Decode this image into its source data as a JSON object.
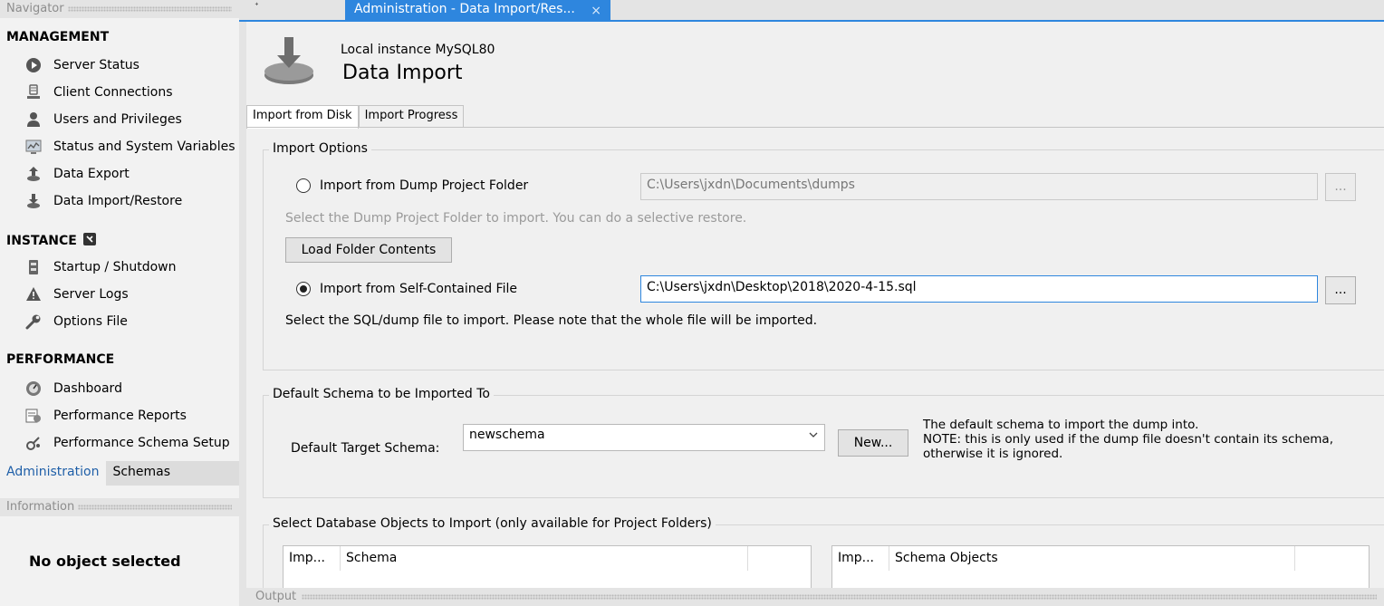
{
  "sidebar": {
    "navigator_title": "Navigator",
    "management_title": "MANAGEMENT",
    "management_items": [
      {
        "label": "Server Status",
        "icon": "server-status-icon"
      },
      {
        "label": "Client Connections",
        "icon": "client-connections-icon"
      },
      {
        "label": "Users and Privileges",
        "icon": "users-icon"
      },
      {
        "label": "Status and System Variables",
        "icon": "system-variables-icon"
      },
      {
        "label": "Data Export",
        "icon": "data-export-icon"
      },
      {
        "label": "Data Import/Restore",
        "icon": "data-import-icon"
      }
    ],
    "instance_title": "INSTANCE",
    "instance_items": [
      {
        "label": "Startup / Shutdown",
        "icon": "startup-shutdown-icon"
      },
      {
        "label": "Server Logs",
        "icon": "server-logs-icon"
      },
      {
        "label": "Options File",
        "icon": "options-file-icon"
      }
    ],
    "performance_title": "PERFORMANCE",
    "performance_items": [
      {
        "label": "Dashboard",
        "icon": "dashboard-icon"
      },
      {
        "label": "Performance Reports",
        "icon": "performance-reports-icon"
      },
      {
        "label": "Performance Schema Setup",
        "icon": "performance-schema-icon"
      }
    ],
    "tabs": {
      "administration": "Administration",
      "schemas": "Schemas"
    },
    "information_title": "Information",
    "no_object": "No object selected"
  },
  "tabbar": {
    "pin": "ᐩ",
    "active_tab": "Administration - Data Import/Res...",
    "close": "×"
  },
  "header": {
    "instance": "Local instance MySQL80",
    "title": "Data Import"
  },
  "inner_tabs": {
    "import_from_disk": "Import from Disk",
    "import_progress": "Import Progress"
  },
  "import_options": {
    "title": "Import Options",
    "dump_folder_label": "Import from Dump Project Folder",
    "dump_folder_path": "C:\\Users\\jxdn\\Documents\\dumps",
    "dump_folder_hint": "Select the Dump Project Folder to import. You can do a selective restore.",
    "load_folder_button": "Load Folder Contents",
    "self_contained_label": "Import from Self-Contained File",
    "self_contained_path": "C:\\Users\\jxdn\\Desktop\\2018\\2020-4-15.sql",
    "self_contained_hint": "Select the SQL/dump file to import. Please note that the whole file will be imported.",
    "browse_label": "...",
    "selected_option": "self_contained"
  },
  "default_schema": {
    "title": "Default Schema to be Imported To",
    "target_label": "Default Target Schema:",
    "selected": "newschema",
    "new_button": "New...",
    "note_line1": "The default schema to import the dump into.",
    "note_line2": "NOTE: this is only used if the dump file doesn't contain its schema,",
    "note_line3": "otherwise it is ignored."
  },
  "objects": {
    "title": "Select Database Objects to Import (only available for Project Folders)",
    "left_columns": [
      "Imp...",
      "Schema"
    ],
    "right_columns": [
      "Imp...",
      "Schema Objects"
    ]
  },
  "output_title": "Output",
  "colors": {
    "accent": "#2e86de",
    "active_tab_text": "#1f5fa8"
  }
}
